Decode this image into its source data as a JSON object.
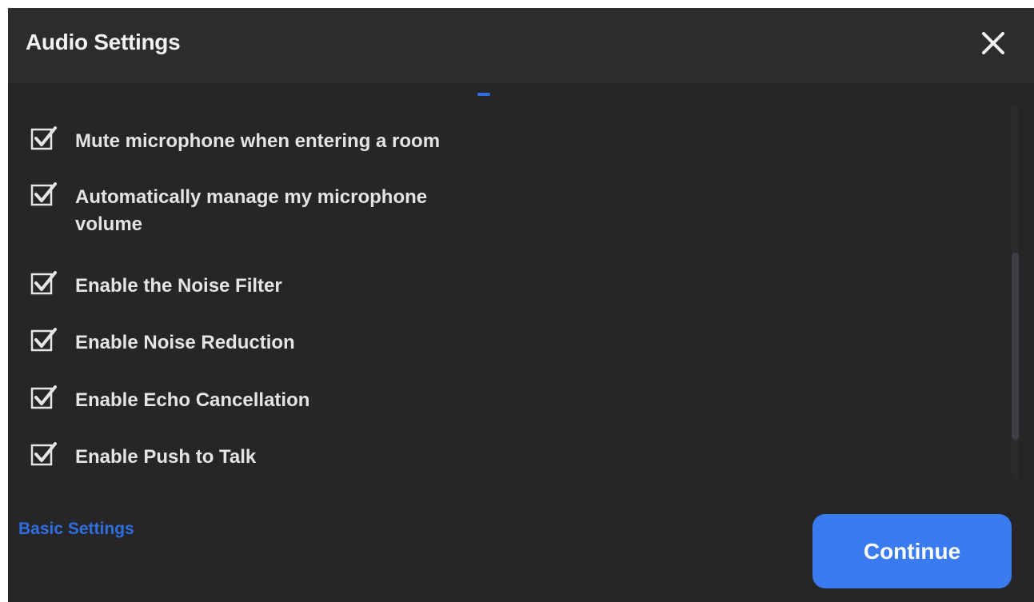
{
  "dialog": {
    "title": "Audio Settings",
    "close_icon": "close-icon"
  },
  "options": [
    {
      "label": "Mute microphone when entering a room",
      "checked": true
    },
    {
      "label": "Automatically manage my microphone volume",
      "checked": true
    },
    {
      "label": "Enable the Noise Filter",
      "checked": true
    },
    {
      "label": "Enable Noise Reduction",
      "checked": true
    },
    {
      "label": "Enable Echo Cancellation",
      "checked": true
    },
    {
      "label": "Enable Push to Talk",
      "checked": true
    }
  ],
  "footer": {
    "basic_settings_label": "Basic Settings",
    "continue_label": "Continue"
  },
  "colors": {
    "background": "#262629",
    "header": "#2c2c2f",
    "accent": "#3a7bf0",
    "link": "#2d6fe0"
  }
}
